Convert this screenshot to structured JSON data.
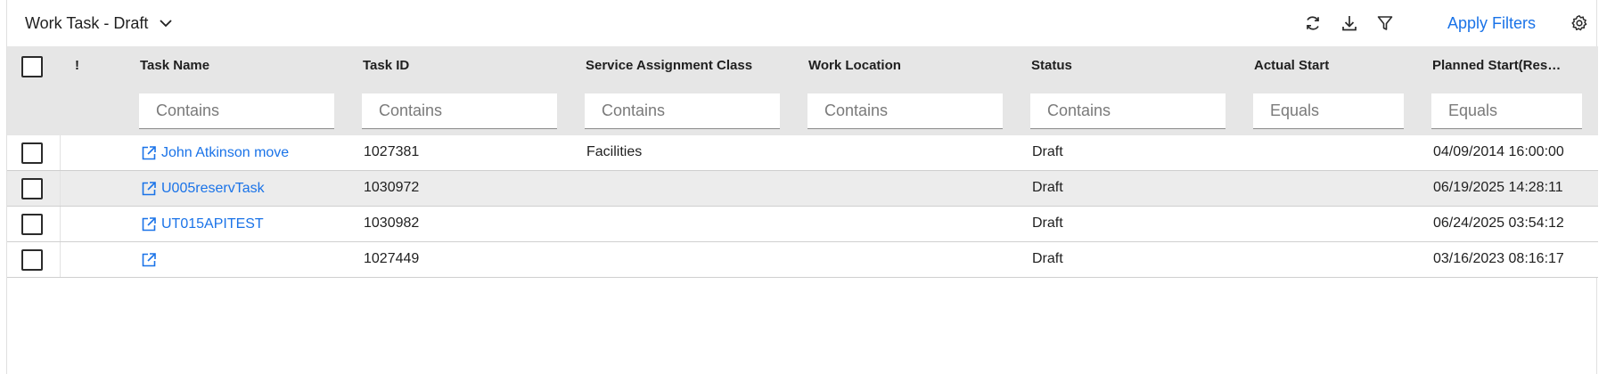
{
  "toolbar": {
    "title": "Work Task - Draft",
    "title_icon": "chevron-down-icon",
    "icons": [
      "refresh-icon",
      "download-icon",
      "filter-icon",
      "gear-icon"
    ],
    "apply_filters_label": "Apply Filters"
  },
  "colors": {
    "link": "#1a73e8",
    "header_bg": "#e6e6e6",
    "row_alt_bg": "#ececec"
  },
  "table": {
    "columns": [
      {
        "key": "priority",
        "label": "!"
      },
      {
        "key": "task_name",
        "label": "Task Name",
        "filter_placeholder": "Contains"
      },
      {
        "key": "task_id",
        "label": "Task ID",
        "filter_placeholder": "Contains"
      },
      {
        "key": "service_assignment_class",
        "label": "Service Assignment Class",
        "filter_placeholder": "Contains"
      },
      {
        "key": "work_location",
        "label": "Work Location",
        "filter_placeholder": "Contains"
      },
      {
        "key": "status",
        "label": "Status",
        "filter_placeholder": "Contains"
      },
      {
        "key": "actual_start",
        "label": "Actual Start",
        "filter_placeholder": "Equals"
      },
      {
        "key": "planned_start",
        "label": "Planned Start(Res…",
        "filter_placeholder": "Equals"
      }
    ],
    "rows": [
      {
        "task_name": "John Atkinson move",
        "task_id": "1027381",
        "service_assignment_class": "Facilities",
        "work_location": "",
        "status": "Draft",
        "actual_start": "",
        "planned_start": "04/09/2014 16:00:00"
      },
      {
        "task_name": "U005reservTask",
        "task_id": "1030972",
        "service_assignment_class": "",
        "work_location": "",
        "status": "Draft",
        "actual_start": "",
        "planned_start": "06/19/2025 14:28:11"
      },
      {
        "task_name": "UT015APITEST",
        "task_id": "1030982",
        "service_assignment_class": "",
        "work_location": "",
        "status": "Draft",
        "actual_start": "",
        "planned_start": "06/24/2025 03:54:12"
      },
      {
        "task_name": "",
        "task_id": "1027449",
        "service_assignment_class": "",
        "work_location": "",
        "status": "Draft",
        "actual_start": "",
        "planned_start": "03/16/2023 08:16:17"
      }
    ]
  }
}
